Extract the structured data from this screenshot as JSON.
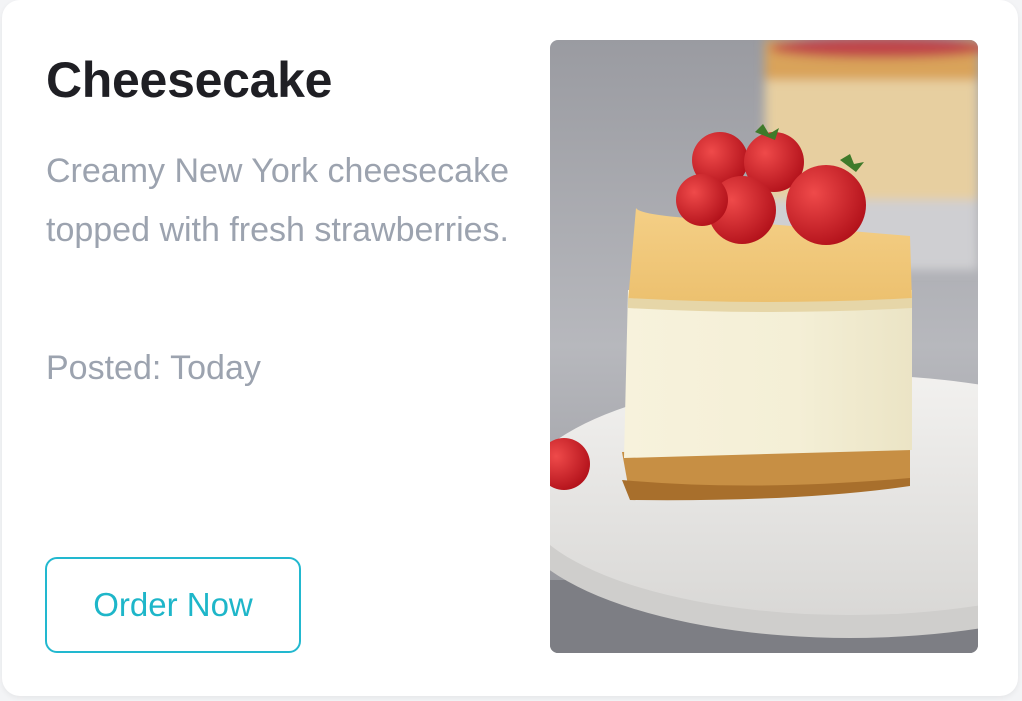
{
  "card": {
    "title": "Cheesecake",
    "description": "Creamy New York cheesecake topped with fresh strawberries.",
    "posted": "Posted: Today",
    "button_label": "Order Now",
    "image_alt": "Cheesecake slice topped with strawberries",
    "accent_color": "#22b8cf"
  }
}
